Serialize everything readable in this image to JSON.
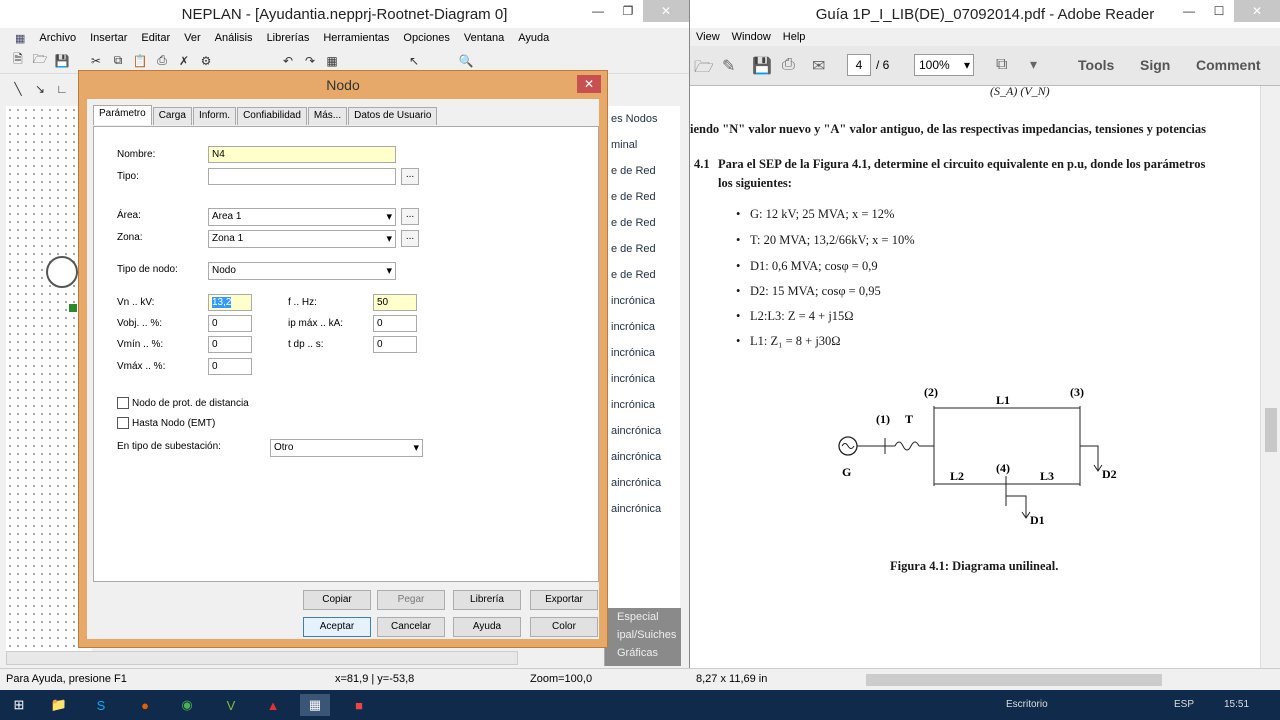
{
  "neplan": {
    "title": "NEPLAN - [Ayudantia.nepprj-Rootnet-Diagram 0]",
    "menu": [
      "Archivo",
      "Insertar",
      "Editar",
      "Ver",
      "Análisis",
      "Librerías",
      "Herramientas",
      "Opciones",
      "Ventana",
      "Ayuda"
    ],
    "right_panel": [
      "es Nodos",
      "minal",
      "e de Red",
      "e de Red",
      "e de Red",
      "e de Red",
      "e de Red",
      "incrónica",
      "incrónica",
      "incrónica",
      "incrónica",
      "incrónica",
      "aincrónica",
      "aincrónica",
      "aincrónica",
      "aincrónica"
    ],
    "right_panel_bottom": [
      "Especial",
      "ipal/Suiches",
      "Gráficas"
    ],
    "status": {
      "help": "Para Ayuda, presione F1",
      "coords": "x=81,9 | y=-53,8",
      "zoom": "Zoom=100,0"
    }
  },
  "dialog": {
    "title": "Nodo",
    "tabs": [
      "Parámetro",
      "Carga",
      "Inform.",
      "Confiabilidad",
      "Más...",
      "Datos de Usuario"
    ],
    "labels": {
      "nombre": "Nombre:",
      "tipo": "Tipo:",
      "area": "Área:",
      "zona": "Zona:",
      "tipo_nodo": "Tipo de nodo:",
      "vn": "Vn .. kV:",
      "vobj": "Vobj. .. %:",
      "vmin": "Vmín .. %:",
      "vmax": "Vmáx .. %:",
      "f": "f .. Hz:",
      "ip": "ip máx .. kA:",
      "tdp": "t dp .. s:",
      "chk1": "Nodo de prot. de distancia",
      "chk2": "Hasta Nodo (EMT)",
      "subest": "En tipo de subestación:"
    },
    "values": {
      "nombre": "N4",
      "tipo": "",
      "area": "Area 1",
      "zona": "Zona 1",
      "tipo_nodo": "Nodo",
      "vn": "13,2",
      "vobj": "0",
      "vmin": "0",
      "vmax": "0",
      "f": "50",
      "ip": "0",
      "tdp": "0",
      "subest": "Otro"
    },
    "buttons": {
      "copiar": "Copiar",
      "pegar": "Pegar",
      "libreria": "Librería",
      "exportar": "Exportar",
      "aceptar": "Aceptar",
      "cancelar": "Cancelar",
      "ayuda": "Ayuda",
      "color": "Color"
    },
    "dots": "..."
  },
  "adobe": {
    "title": "Guía 1P_I_LIB(DE)_07092014.pdf - Adobe Reader",
    "menu": [
      "View",
      "Window",
      "Help"
    ],
    "page": "4",
    "pages": "/ 6",
    "zoom": "100%",
    "tools": [
      "Tools",
      "Sign",
      "Comment"
    ],
    "line1": "iendo \"N\" valor nuevo y \"A\" valor antiguo, de las respectivas impedancias, tensiones y potencias",
    "q_num": "4.1",
    "q_text1": "Para el SEP de la Figura 4.1, determine el circuito equivalente en p.u, donde los parámetros",
    "q_text2": "los siguientes:",
    "bullets": [
      "G: 12 kV; 25 MVA; x = 12%",
      "T: 20 MVA; 13,2/66kV; x = 10%",
      "D1: 0,6 MVA; cosφ = 0,9",
      "D2: 15 MVA; cosφ = 0,95",
      "L2:L3: Z = 4 + j15Ω",
      "L1: Z₁ = 8 + j30Ω"
    ],
    "diagram": {
      "n1": "(1)",
      "n2": "(2)",
      "n3": "(3)",
      "n4": "(4)",
      "T": "T",
      "G": "G",
      "L1": "L1",
      "L2": "L2",
      "L3": "L3",
      "D1": "D1",
      "D2": "D2"
    },
    "caption": "Figura 4.1: Diagrama unilineal.",
    "status": "8,27 x 11,69 in",
    "top_formula": "(S_A) (V_N)"
  },
  "taskbar": {
    "desktop": "Escritorio",
    "lang": "ESP",
    "time": "15:51"
  }
}
